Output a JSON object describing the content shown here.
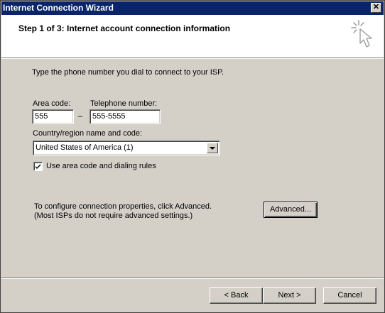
{
  "window": {
    "title": "Internet Connection Wizard",
    "close_label": "✕"
  },
  "header": {
    "step_title": "Step 1 of 3: Internet account connection information",
    "icon": "wizard-cursor-icon"
  },
  "form": {
    "instruction": "Type the phone number you dial to connect to your ISP.",
    "area_code_label": "Area code:",
    "area_code_value": "555",
    "dash": "–",
    "phone_label": "Telephone number:",
    "phone_value": "555-5555",
    "country_label": "Country/region name and code:",
    "country_value": "United States of America (1)",
    "use_area_code_label": "Use area code and dialing rules",
    "use_area_code_checked": true,
    "advanced_note_line1": "To configure connection properties, click Advanced.",
    "advanced_note_line2": "(Most ISPs do not require advanced settings.)",
    "advanced_button": "Advanced..."
  },
  "footer": {
    "back_button": "< Back",
    "next_button": "Next >",
    "cancel_button": "Cancel"
  }
}
